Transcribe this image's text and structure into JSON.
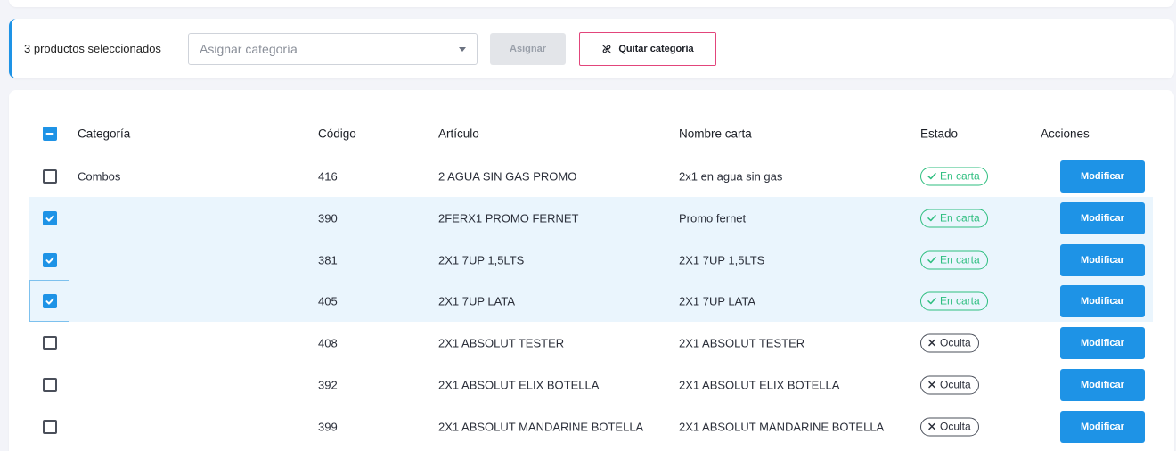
{
  "bulk_bar": {
    "selected_count_text": "3 productos seleccionados",
    "category_placeholder": "Asignar categoría",
    "assign_label": "Asignar",
    "remove_category_label": "Quitar categoría"
  },
  "table": {
    "headers": {
      "category": "Categoría",
      "code": "Código",
      "article": "Artículo",
      "menu_name": "Nombre carta",
      "status": "Estado",
      "actions": "Acciones"
    },
    "modify_label": "Modificar",
    "rows": [
      {
        "selected": false,
        "category": "Combos",
        "code": "416",
        "article": "2 AGUA SIN GAS PROMO",
        "menu_name": "2x1 en agua sin gas",
        "status": "En carta",
        "status_type": "on"
      },
      {
        "selected": true,
        "category": "",
        "code": "390",
        "article": "2FERX1 PROMO FERNET",
        "menu_name": "Promo fernet",
        "status": "En carta",
        "status_type": "on"
      },
      {
        "selected": true,
        "category": "",
        "code": "381",
        "article": "2X1 7UP 1,5LTS",
        "menu_name": "2X1 7UP 1,5LTS",
        "status": "En carta",
        "status_type": "on"
      },
      {
        "selected": true,
        "category": "",
        "code": "405",
        "article": "2X1 7UP LATA",
        "menu_name": "2X1 7UP LATA",
        "status": "En carta",
        "status_type": "on"
      },
      {
        "selected": false,
        "category": "",
        "code": "408",
        "article": "2X1 ABSOLUT TESTER",
        "menu_name": "2X1 ABSOLUT TESTER",
        "status": "Oculta",
        "status_type": "off"
      },
      {
        "selected": false,
        "category": "",
        "code": "392",
        "article": "2X1 ABSOLUT ELIX BOTELLA",
        "menu_name": "2X1 ABSOLUT ELIX BOTELLA",
        "status": "Oculta",
        "status_type": "off"
      },
      {
        "selected": false,
        "category": "",
        "code": "399",
        "article": "2X1 ABSOLUT MANDARINE BOTELLA",
        "menu_name": "2X1 ABSOLUT MANDARINE BOTELLA",
        "status": "Oculta",
        "status_type": "off"
      }
    ]
  },
  "colors": {
    "accent": "#1e93e6",
    "status_on": "#2dbe7f",
    "danger_border": "#e2457b",
    "selected_row": "#eaf5fd"
  },
  "icons": {
    "remove_category": "link-off-icon",
    "status_on": "check-icon",
    "status_off": "x-icon",
    "select_caret": "chevron-down-icon"
  }
}
